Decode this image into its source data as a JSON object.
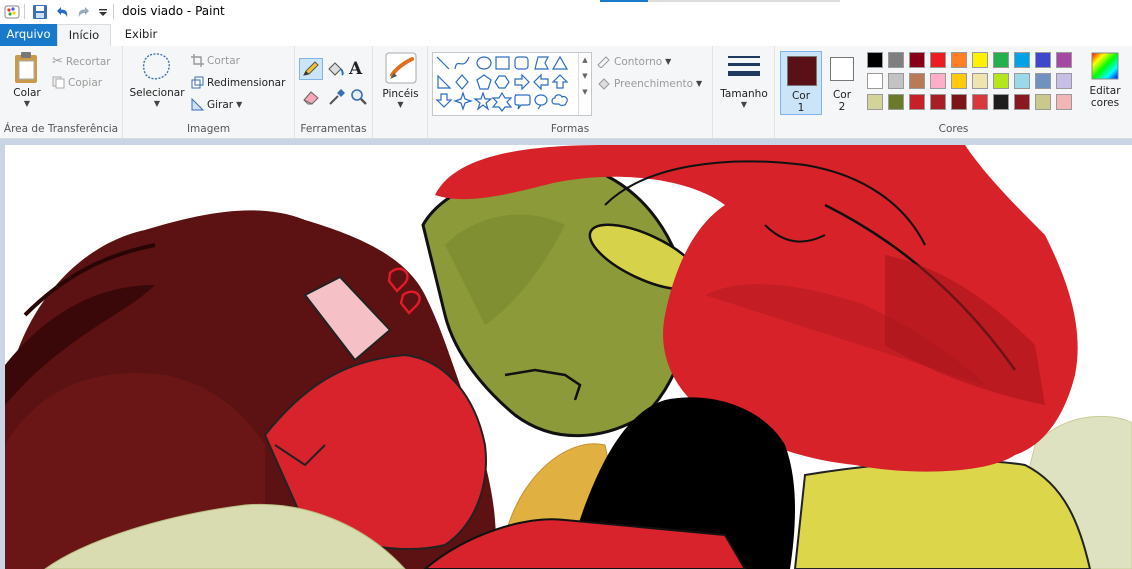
{
  "window": {
    "title": "dois viado - Paint"
  },
  "quick_access": {
    "icons": [
      "paint-app-icon",
      "save-icon",
      "undo-icon",
      "redo-icon",
      "customize-dropdown-icon"
    ]
  },
  "tabs": {
    "file": "Arquivo",
    "home": "Início",
    "view": "Exibir"
  },
  "clipboard": {
    "paste": "Colar",
    "cut": "Recortar",
    "copy": "Copiar",
    "label": "Área de Transferência"
  },
  "image": {
    "select": "Selecionar",
    "crop": "Cortar",
    "resize": "Redimensionar",
    "rotate": "Girar",
    "label": "Imagem"
  },
  "tools": {
    "label": "Ferramentas",
    "active": "pencil"
  },
  "brushes": {
    "label": "Pincéis"
  },
  "shapes": {
    "outline": "Contorno",
    "fill": "Preenchimento",
    "label": "Formas"
  },
  "size": {
    "label": "Tamanho"
  },
  "colors": {
    "color1_label": "Cor",
    "color1_num": "1",
    "color2_label": "Cor",
    "color2_num": "2",
    "color1": "#5a1017",
    "color2": "#ffffff",
    "edit_label": "Editar",
    "edit_label2": "cores",
    "label": "Cores",
    "palette": [
      "#000000",
      "#7f7f7f",
      "#880015",
      "#ed1c24",
      "#ff7f27",
      "#fff200",
      "#22b14c",
      "#00a2e8",
      "#3f48cc",
      "#a349a4",
      "#ffffff",
      "#c3c3c3",
      "#b97a57",
      "#ffaec9",
      "#ffc90e",
      "#efe4b0",
      "#b5e61d",
      "#99d9ea",
      "#7092be",
      "#c8bfe7",
      "#d3d49a",
      "#6b7a2a",
      "#c72029",
      "#a81e24",
      "#7d1418",
      "#d9383c",
      "#1e1e1e",
      "#8a1820",
      "#c9c98b",
      "#f2b6b6"
    ]
  },
  "canvas": {
    "description_name": "drawing-canvas"
  }
}
